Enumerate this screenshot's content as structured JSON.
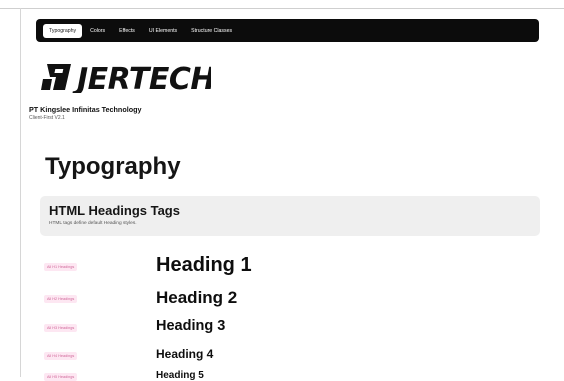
{
  "nav": {
    "tabs": [
      {
        "label": "Typography",
        "active": true
      },
      {
        "label": "Colors",
        "active": false
      },
      {
        "label": "Effects",
        "active": false
      },
      {
        "label": "UI Elements",
        "active": false
      },
      {
        "label": "Structure Classes",
        "active": false
      }
    ]
  },
  "brand": {
    "logo_text": "JERTECH",
    "company": "PT Kingslee Infinitas Technology",
    "version": "Client-First V2.1"
  },
  "page": {
    "title": "Typography"
  },
  "section": {
    "title": "HTML Headings Tags",
    "description": "HTML tags define default Heading styles."
  },
  "headings": [
    {
      "tag": "All H1 Headings",
      "text": "Heading 1"
    },
    {
      "tag": "All H2 Headings",
      "text": "Heading 2"
    },
    {
      "tag": "All H3 Headings",
      "text": "Heading 3"
    },
    {
      "tag": "All H4 Headings",
      "text": "Heading 4"
    },
    {
      "tag": "All H5 Headings",
      "text": "Heading 5"
    }
  ],
  "colors": {
    "nav_bg": "#0c0c0c",
    "tag_bg": "#fde7f2",
    "tag_text": "#d0689a",
    "section_bg": "#efefef"
  }
}
